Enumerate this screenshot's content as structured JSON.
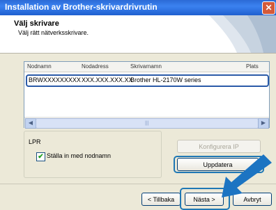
{
  "window": {
    "title": "Installation av Brother-skrivardrivrutin",
    "close_glyph": "✕"
  },
  "header": {
    "title": "Välj skrivare",
    "subtitle": "Välj rätt nätverksskrivare."
  },
  "list": {
    "columns": [
      "Nodnamn",
      "Nodadress",
      "Skrivarnamn",
      "Plats"
    ],
    "rows": [
      {
        "node_name": "BRWXXXXXXXXX",
        "node_address": "XXX.XXX.XXX.XX",
        "printer_name": "Brother HL-2170W series",
        "location": ""
      }
    ]
  },
  "options": {
    "group_label": "LPR",
    "checkbox_label": "Ställa in med nodnamn",
    "checkbox_checked": true,
    "check_glyph": "✔"
  },
  "buttons": {
    "configure_ip": "Konfigurera IP",
    "update": "Uppdatera",
    "back": "< Tillbaka",
    "next": "Nästa >",
    "cancel": "Avbryt"
  },
  "colors": {
    "highlight": "#1f78b5",
    "title_bar": "#2b6ad6",
    "arrow": "#1c74c2"
  }
}
